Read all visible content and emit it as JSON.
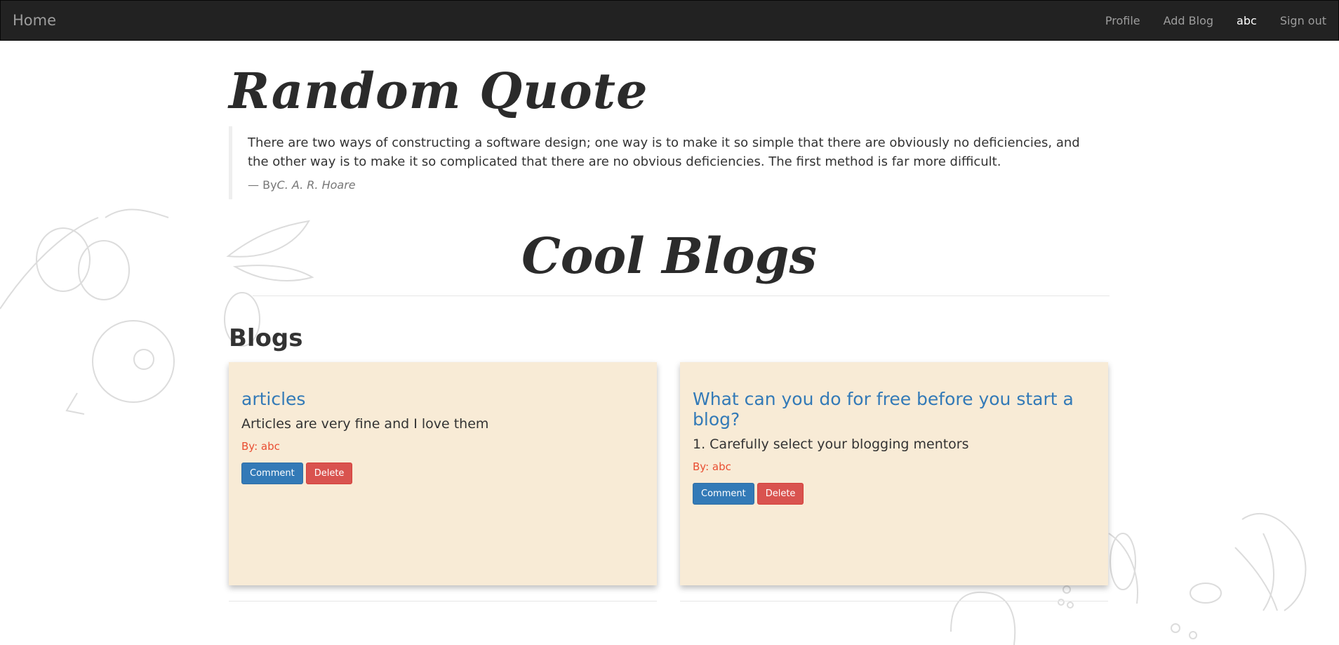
{
  "navbar": {
    "brand": "Home",
    "links": [
      {
        "label": "Profile"
      },
      {
        "label": "Add Blog"
      },
      {
        "label": "abc"
      },
      {
        "label": "Sign out"
      }
    ]
  },
  "quote": {
    "title": "Random Quote",
    "text": "There are two ways of constructing a software design; one way is to make it so simple that there are obviously no deficiencies, and the other way is to make it so complicated that there are no obvious deficiencies. The first method is far more difficult.",
    "by_prefix": "— By",
    "author": "C. A. R. Hoare"
  },
  "main": {
    "heading": "Cool Blogs",
    "section_title": "Blogs"
  },
  "blogs": [
    {
      "title": "articles",
      "description": "Articles are very fine and I love them",
      "author_line": "By: abc",
      "comment_label": "Comment",
      "delete_label": "Delete"
    },
    {
      "title": "What can you do for free before you start a blog?",
      "description": "1. Carefully select your blogging mentors",
      "author_line": "By: abc",
      "comment_label": "Comment",
      "delete_label": "Delete"
    }
  ],
  "colors": {
    "navbar_bg": "#222222",
    "card_bg": "#f8ebd6",
    "link_blue": "#337ab7",
    "author_red": "#e94e32",
    "primary": "#337ab7",
    "danger": "#d9534f"
  }
}
